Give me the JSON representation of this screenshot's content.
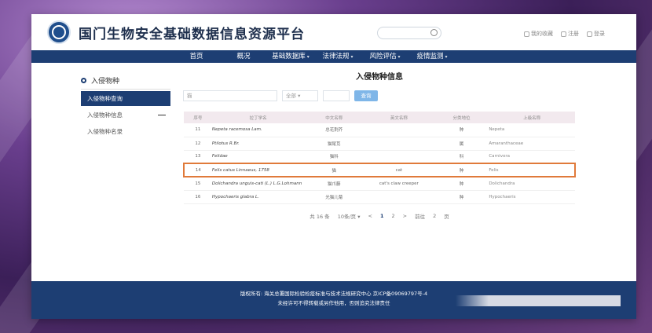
{
  "header": {
    "title": "国门生物安全基础数据信息资源平台",
    "search_placeholder": "",
    "links": [
      "我的收藏",
      "注册",
      "登录"
    ]
  },
  "nav": {
    "items": [
      "首页",
      "概况",
      "基础数据库",
      "法律法规",
      "风险评估",
      "疫情监测"
    ],
    "has_dropdown": [
      false,
      false,
      true,
      true,
      true,
      true
    ]
  },
  "sidebar": {
    "title": "入侵物种",
    "items": [
      "入侵物种查询",
      "入侵物种信息",
      "入侵物种名录"
    ]
  },
  "main": {
    "title": "入侵物种信息",
    "filters": {
      "keyword": "猫",
      "field": "全部",
      "range": "",
      "search_button": "查询"
    },
    "table": {
      "columns": [
        "序号",
        "拉丁学名",
        "中文名称",
        "英文名称",
        "分类地位",
        "上级名称"
      ],
      "rows": [
        [
          "11",
          "Nepeta racemosa Lam.",
          "总花荆芥",
          "",
          "种",
          "Nepeta"
        ],
        [
          "12",
          "Ptilotus R.Br.",
          "猫尾苋",
          "",
          "属",
          "Amaranthaceae"
        ],
        [
          "13",
          "Felidae",
          "猫科",
          "",
          "科",
          "Carnivora"
        ],
        [
          "14",
          "Felis catus Linnaeus, 1758",
          "猫",
          "cat",
          "种",
          "Felis"
        ],
        [
          "15",
          "Dolichandra unguis-cati (L.) L.G.Lohmann",
          "猫爪藤",
          "cat's claw creeper",
          "种",
          "Dolichandra"
        ],
        [
          "16",
          "Hypochaeris glabra L.",
          "光猫儿菊",
          "",
          "种",
          "Hypochaeris"
        ]
      ],
      "highlight_row": 3
    },
    "pager": {
      "total": "共 16 条",
      "page_size": "10条/页",
      "prev": "<",
      "pages": [
        "1",
        "2"
      ],
      "current": "1",
      "next": ">",
      "goto_label": "前往",
      "goto_value": "2",
      "page_suffix": "页"
    }
  },
  "footer": {
    "line1": "版权所有: 海关总署国际检验检疫标准与技术法规研究中心 京ICP备09069797号-4",
    "line2": "未经许可不得转载或另作他用，否则追究法律责任"
  },
  "colors": {
    "primary": "#1d3e73",
    "highlight": "#e07a3a",
    "search_btn": "#7fb6e8"
  }
}
